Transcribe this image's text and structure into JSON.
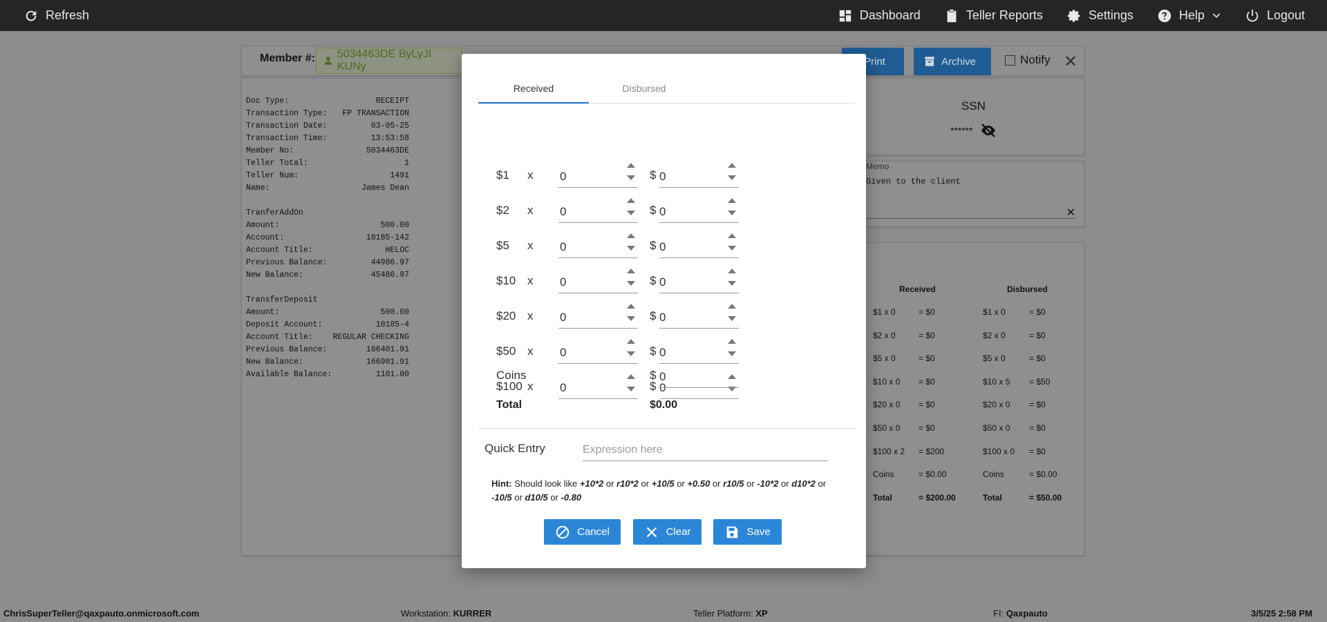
{
  "topbar": {
    "refresh": "Refresh",
    "dashboard": "Dashboard",
    "teller_reports": "Teller Reports",
    "settings": "Settings",
    "help": "Help",
    "logout": "Logout"
  },
  "member": {
    "label": "Member #:",
    "value": "5034463DE ByLyJI KUNy"
  },
  "actions": {
    "print": "Print",
    "archive": "Archive",
    "notify": "Notify"
  },
  "receipt": {
    "header_rows": [
      {
        "k": "Doc Type:",
        "v": "RECEIPT"
      },
      {
        "k": "Transaction Type:",
        "v": "FP TRANSACTION"
      },
      {
        "k": "Transaction Date:",
        "v": "03-05-25"
      },
      {
        "k": "Transaction Time:",
        "v": "13:53:58"
      },
      {
        "k": "Member No:",
        "v": "5034463DE"
      },
      {
        "k": "Teller Total:",
        "v": "1"
      },
      {
        "k": "Teller Num:",
        "v": "1491"
      },
      {
        "k": "Name:",
        "v": "James Dean"
      }
    ],
    "section1": "TranferAddOn",
    "section1_rows": [
      {
        "k": "Amount:",
        "v": "500.00"
      },
      {
        "k": "Account:",
        "v": "10185-142"
      },
      {
        "k": "Account Title:",
        "v": "HELOC"
      },
      {
        "k": "Previous Balance:",
        "v": "44986.97"
      },
      {
        "k": "New Balance:",
        "v": "45486.97"
      }
    ],
    "section2": "TransferDeposit",
    "section2_rows": [
      {
        "k": "Amount:",
        "v": "500.00"
      },
      {
        "k": "Deposit Account:",
        "v": "10185-4"
      },
      {
        "k": "Account Title:",
        "v": "REGULAR CHECKING"
      },
      {
        "k": "Previous Balance:",
        "v": "166401.91"
      },
      {
        "k": "New Balance:",
        "v": "166901.91"
      },
      {
        "k": "Available Balance:",
        "v": "1101.00"
      }
    ]
  },
  "ssn": {
    "title": "SSN",
    "mask": "******"
  },
  "memo": {
    "label": "Memo",
    "text": "Given to the client"
  },
  "summary": {
    "received_head": "Received",
    "disbursed_head": "Disbursed",
    "rows": [
      {
        "r": "$1 x 0",
        "rv": "= $0",
        "d": "$1 x 0",
        "dv": "= $0"
      },
      {
        "r": "$2 x 0",
        "rv": "= $0",
        "d": "$2 x 0",
        "dv": "= $0"
      },
      {
        "r": "$5 x 0",
        "rv": "= $0",
        "d": "$5 x 0",
        "dv": "= $0"
      },
      {
        "r": "$10 x 0",
        "rv": "= $0",
        "d": "$10 x 5",
        "dv": "= $50"
      },
      {
        "r": "$20 x 0",
        "rv": "= $0",
        "d": "$20 x 0",
        "dv": "= $0"
      },
      {
        "r": "$50 x 0",
        "rv": "= $0",
        "d": "$50 x 0",
        "dv": "= $0"
      },
      {
        "r": "$100 x 2",
        "rv": "= $200",
        "d": "$100 x 0",
        "dv": "= $0"
      },
      {
        "r": "Coins",
        "rv": "= $0.00",
        "d": "Coins",
        "dv": "= $0.00"
      },
      {
        "r": "Total",
        "rv": "= $200.00",
        "d": "Total",
        "dv": "= $50.00"
      }
    ]
  },
  "status": {
    "user": "ChrisSuperTeller@qaxpauto.onmicrosoft.com",
    "workstation_label": "Workstation:",
    "workstation": "KURRER",
    "platform_label": "Teller Platform:",
    "platform": "XP",
    "fi_label": "FI:",
    "fi": "Qaxpauto",
    "datetime": "3/5/25 2:58 PM"
  },
  "modal": {
    "tabs": [
      "Received",
      "Disbursed"
    ],
    "denominations": [
      {
        "label": "$1",
        "x": "x",
        "qty": "0",
        "dollar": "$",
        "amount": "0"
      },
      {
        "label": "$2",
        "x": "x",
        "qty": "0",
        "dollar": "$",
        "amount": "0"
      },
      {
        "label": "$5",
        "x": "x",
        "qty": "0",
        "dollar": "$",
        "amount": "0"
      },
      {
        "label": "$10",
        "x": "x",
        "qty": "0",
        "dollar": "$",
        "amount": "0"
      },
      {
        "label": "$20",
        "x": "x",
        "qty": "0",
        "dollar": "$",
        "amount": "0"
      },
      {
        "label": "$50",
        "x": "x",
        "qty": "0",
        "dollar": "$",
        "amount": "0"
      },
      {
        "label": "$100",
        "x": "x",
        "qty": "0",
        "dollar": "$",
        "amount": "0"
      }
    ],
    "coins": {
      "label": "Coins",
      "dollar": "$",
      "amount": "0"
    },
    "total": {
      "label": "Total",
      "value": "$0.00"
    },
    "quick_entry": {
      "label": "Quick Entry",
      "placeholder": "Expression here"
    },
    "hint": {
      "prefix": "Hint:",
      "intro": "Should look like",
      "or": "or",
      "examples": [
        "+10*2",
        "r10*2",
        "+10/5",
        "+0.50",
        "r10/5",
        "-10*2",
        "d10*2",
        "-10/5",
        "d10/5",
        "-0.80"
      ]
    },
    "buttons": {
      "cancel": "Cancel",
      "clear": "Clear",
      "save": "Save"
    }
  }
}
